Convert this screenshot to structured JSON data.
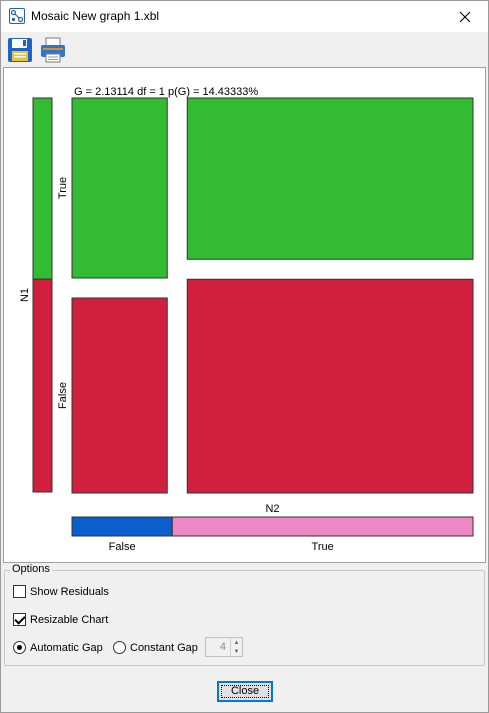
{
  "window": {
    "title": "Mosaic New graph 1.xbl",
    "icons": {
      "app": "graph-app-icon",
      "close": "close-icon"
    }
  },
  "toolbar": {
    "items": [
      {
        "icon": "save-icon"
      },
      {
        "icon": "print-icon"
      }
    ]
  },
  "chart_data": {
    "type": "mosaic",
    "stats_text": "G = 2.13114 df = 1 p(G) = 14.43333%",
    "x_variable": "N2",
    "y_variable": "N1",
    "x_categories": [
      "False",
      "True"
    ],
    "y_categories": [
      "True",
      "False"
    ],
    "x_proportions": [
      0.25,
      0.75
    ],
    "y_marginal_proportions": [
      0.46,
      0.54
    ],
    "cells": [
      {
        "x": "False",
        "y": "True",
        "proportion_within_x": 0.48
      },
      {
        "x": "False",
        "y": "False",
        "proportion_within_x": 0.52
      },
      {
        "x": "True",
        "y": "True",
        "proportion_within_x": 0.43
      },
      {
        "x": "True",
        "y": "False",
        "proportion_within_x": 0.57
      }
    ],
    "colors": {
      "y_true": "#33bb33",
      "y_false": "#d11f3e",
      "x_false": "#0a5fcc",
      "x_true": "#ee88c4"
    }
  },
  "options": {
    "legend": "Options",
    "show_residuals": {
      "label": "Show Residuals",
      "checked": false
    },
    "resizable_chart": {
      "label": "Resizable Chart",
      "checked": true
    },
    "automatic_gap": {
      "label": "Automatic Gap",
      "selected": true
    },
    "constant_gap": {
      "label": "Constant Gap",
      "selected": false
    },
    "gap_value": "4"
  },
  "footer": {
    "close_label": "Close"
  }
}
